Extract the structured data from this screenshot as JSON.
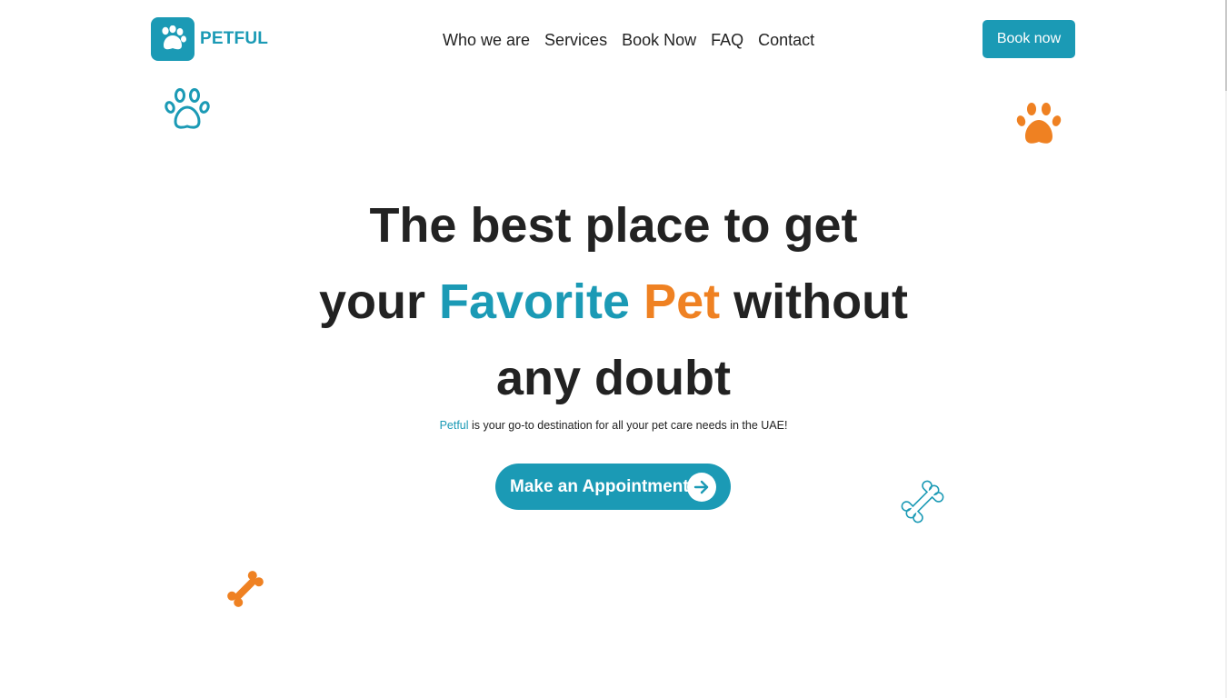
{
  "brand": {
    "name": "PETFUL",
    "primary_color": "#1b9ab5",
    "accent_color": "#ef8122",
    "logo_icon": "paw-logo-icon"
  },
  "nav": {
    "items": [
      {
        "label": "Who we are"
      },
      {
        "label": "Services"
      },
      {
        "label": "Book Now"
      },
      {
        "label": "FAQ"
      },
      {
        "label": "Contact"
      }
    ],
    "cta_label": "Book now"
  },
  "hero": {
    "line1": "The best place to get",
    "line2_pre": "your ",
    "line2_blue": "Favorite",
    "line2_space": " ",
    "line2_orange": "Pet",
    "line2_post": " without",
    "line3": "any doubt",
    "tagline_brand": "Petful",
    "tagline_rest": " is your go-to destination for all your pet care needs in the UAE!",
    "cta_label": "Make an Appointment",
    "cta_icon": "arrow-right-icon"
  },
  "decorations": [
    {
      "icon": "paw-outline-icon",
      "color": "#1b9ab5"
    },
    {
      "icon": "paw-solid-icon",
      "color": "#ef8122"
    },
    {
      "icon": "bone-outline-icon",
      "color": "#1b9ab5"
    },
    {
      "icon": "bone-solid-icon",
      "color": "#ef8122"
    }
  ]
}
